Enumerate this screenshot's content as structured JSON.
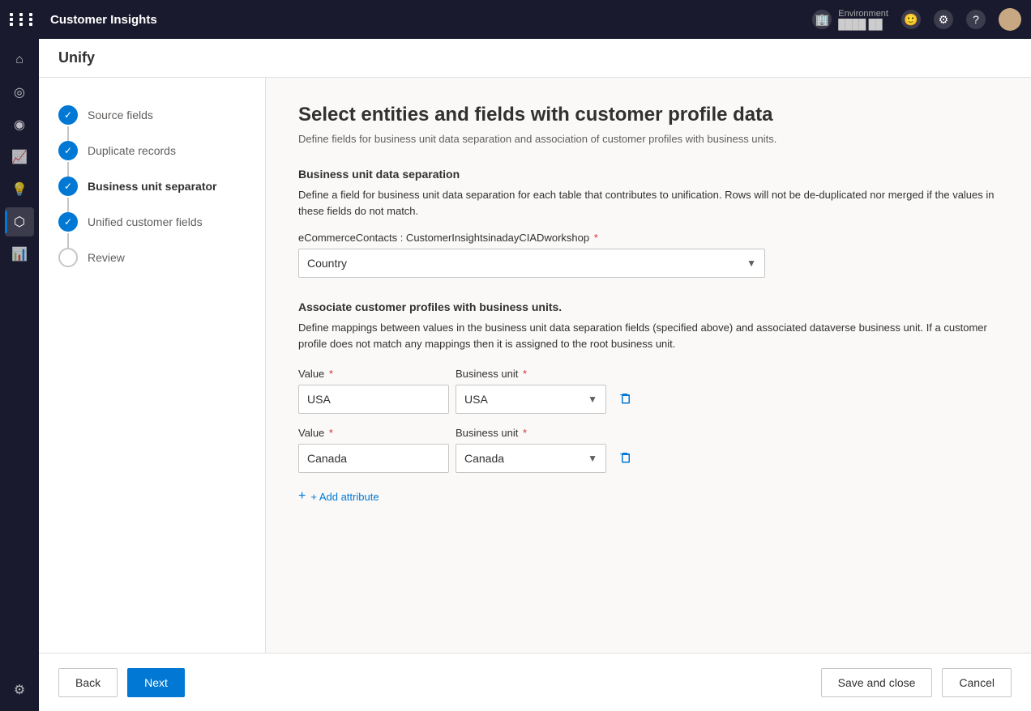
{
  "app": {
    "title": "Customer Insights",
    "page_title": "Unify"
  },
  "env": {
    "label": "Environment",
    "value": "████ ██"
  },
  "nav_icons": [
    {
      "name": "grid-icon",
      "symbol": "⊞"
    },
    {
      "name": "home-icon",
      "symbol": "⌂"
    },
    {
      "name": "analytics-icon",
      "symbol": "◎"
    },
    {
      "name": "target-icon",
      "symbol": "◉"
    },
    {
      "name": "chart-icon",
      "symbol": "📈"
    },
    {
      "name": "bulb-icon",
      "symbol": "💡"
    },
    {
      "name": "segments-icon",
      "symbol": "⬡"
    },
    {
      "name": "reports-icon",
      "symbol": "📊"
    },
    {
      "name": "settings-icon",
      "symbol": "⚙"
    }
  ],
  "steps": [
    {
      "id": "source-fields",
      "label": "Source fields",
      "state": "completed"
    },
    {
      "id": "duplicate-records",
      "label": "Duplicate records",
      "state": "completed"
    },
    {
      "id": "business-unit-separator",
      "label": "Business unit separator",
      "state": "active"
    },
    {
      "id": "unified-customer-fields",
      "label": "Unified customer fields",
      "state": "completed"
    },
    {
      "id": "review",
      "label": "Review",
      "state": "pending"
    }
  ],
  "main": {
    "title": "Select entities and fields with customer profile data",
    "subtitle": "Define fields for business unit data separation and association of customer profiles with business units.",
    "business_unit_section": {
      "title": "Business unit data separation",
      "description": "Define a field for business unit data separation for each table that contributes to unification. Rows will not be de-duplicated nor merged if the values in these fields do not match.",
      "field_label": "eCommerceContacts : CustomerInsightsinadayCIADworkshop",
      "required_marker": "*",
      "dropdown_value": "Country",
      "dropdown_placeholder": "Country"
    },
    "associate_section": {
      "title": "Associate customer profiles with business units.",
      "description": "Define mappings between values in the business unit data separation fields (specified above) and associated dataverse business unit. If a customer profile does not match any mappings then it is assigned to the root business unit.",
      "rows": [
        {
          "value_label": "Value",
          "required": "*",
          "value": "USA",
          "business_unit_label": "Business unit",
          "business_unit_value": "USA"
        },
        {
          "value_label": "Value",
          "required": "*",
          "value": "Canada",
          "business_unit_label": "Business unit",
          "business_unit_value": "Canada"
        }
      ],
      "add_attribute_label": "+ Add attribute"
    }
  },
  "footer": {
    "back_label": "Back",
    "next_label": "Next",
    "save_close_label": "Save and close",
    "cancel_label": "Cancel"
  }
}
